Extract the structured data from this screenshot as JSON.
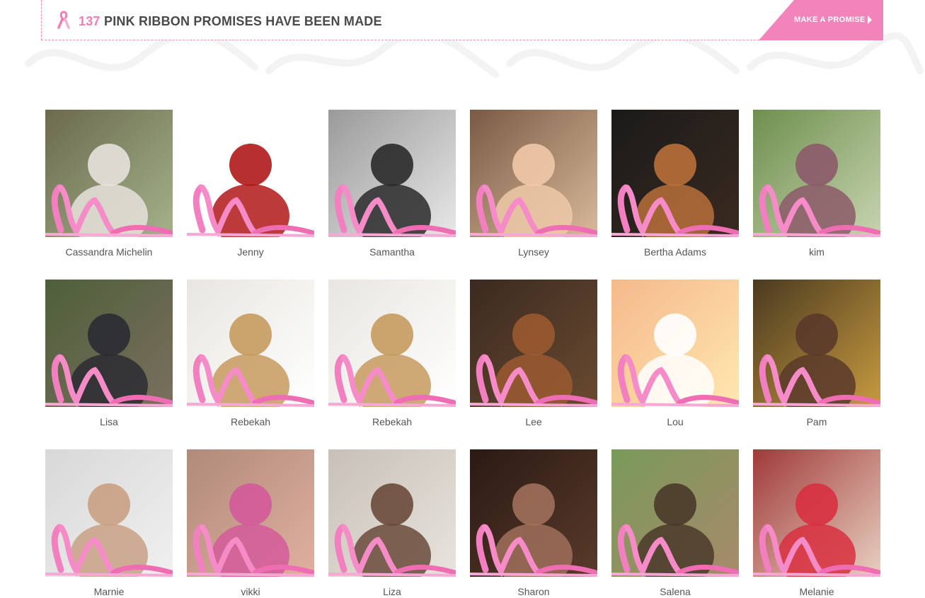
{
  "banner": {
    "count": "137",
    "headline": "PINK RIBBON PROMISES HAVE BEEN MADE",
    "cta_label": "MAKE A PROMISE",
    "icons": [
      "pink-ribbon-icon",
      "chevron-right-icon"
    ]
  },
  "colors": {
    "accent": "#ef7fb4",
    "ribbon": "#f27fc0",
    "text": "#555555",
    "heading": "#4a4a4a"
  },
  "promises": [
    {
      "name": "Cassandra Michelin",
      "bg": [
        "#6b6a4e",
        "#a4b28a"
      ],
      "subject": "#e6e2dc"
    },
    {
      "name": "Jenny",
      "bg": [
        "#ffffff",
        "#ffffff"
      ],
      "subject": "#b01818"
    },
    {
      "name": "Samantha",
      "bg": [
        "#9a9a9a",
        "#e8e8e8"
      ],
      "subject": "#2a2a2a"
    },
    {
      "name": "Lynsey",
      "bg": [
        "#7a5a44",
        "#d9b99a"
      ],
      "subject": "#efc9a8"
    },
    {
      "name": "Bertha Adams",
      "bg": [
        "#1a1a1a",
        "#3a2a20"
      ],
      "subject": "#b8703a"
    },
    {
      "name": "kim",
      "bg": [
        "#6f8f4e",
        "#c7d4b0"
      ],
      "subject": "#8c5a6a"
    },
    {
      "name": "Lisa",
      "bg": [
        "#4e5f3a",
        "#7a6f5e"
      ],
      "subject": "#2b2b33"
    },
    {
      "name": "Rebekah",
      "bg": [
        "#e8e6e0",
        "#ffffff"
      ],
      "subject": "#c79a5e"
    },
    {
      "name": "Rebekah",
      "bg": [
        "#e8e6e0",
        "#ffffff"
      ],
      "subject": "#c79a5e"
    },
    {
      "name": "Lee",
      "bg": [
        "#3a2a20",
        "#6a4a30"
      ],
      "subject": "#9a5a30"
    },
    {
      "name": "Lou",
      "bg": [
        "#f5b98a",
        "#ffe7b0"
      ],
      "subject": "#ffffff"
    },
    {
      "name": "Pam",
      "bg": [
        "#4a3a20",
        "#c79a40"
      ],
      "subject": "#5a3a2a"
    },
    {
      "name": "Marnie",
      "bg": [
        "#d8d8d8",
        "#f0f0f0"
      ],
      "subject": "#c9a084"
    },
    {
      "name": "vikki",
      "bg": [
        "#b08a7a",
        "#e0b0a0"
      ],
      "subject": "#d35a9a"
    },
    {
      "name": "Liza",
      "bg": [
        "#c8c0b8",
        "#e8e4de"
      ],
      "subject": "#6a4a3a"
    },
    {
      "name": "Sharon",
      "bg": [
        "#2a1a14",
        "#5a3a2a"
      ],
      "subject": "#a0705a"
    },
    {
      "name": "Salena",
      "bg": [
        "#7a9a5a",
        "#a68a6a"
      ],
      "subject": "#4a3a2a"
    },
    {
      "name": "Melanie",
      "bg": [
        "#a03a3a",
        "#e8d0c0"
      ],
      "subject": "#d83040"
    }
  ]
}
